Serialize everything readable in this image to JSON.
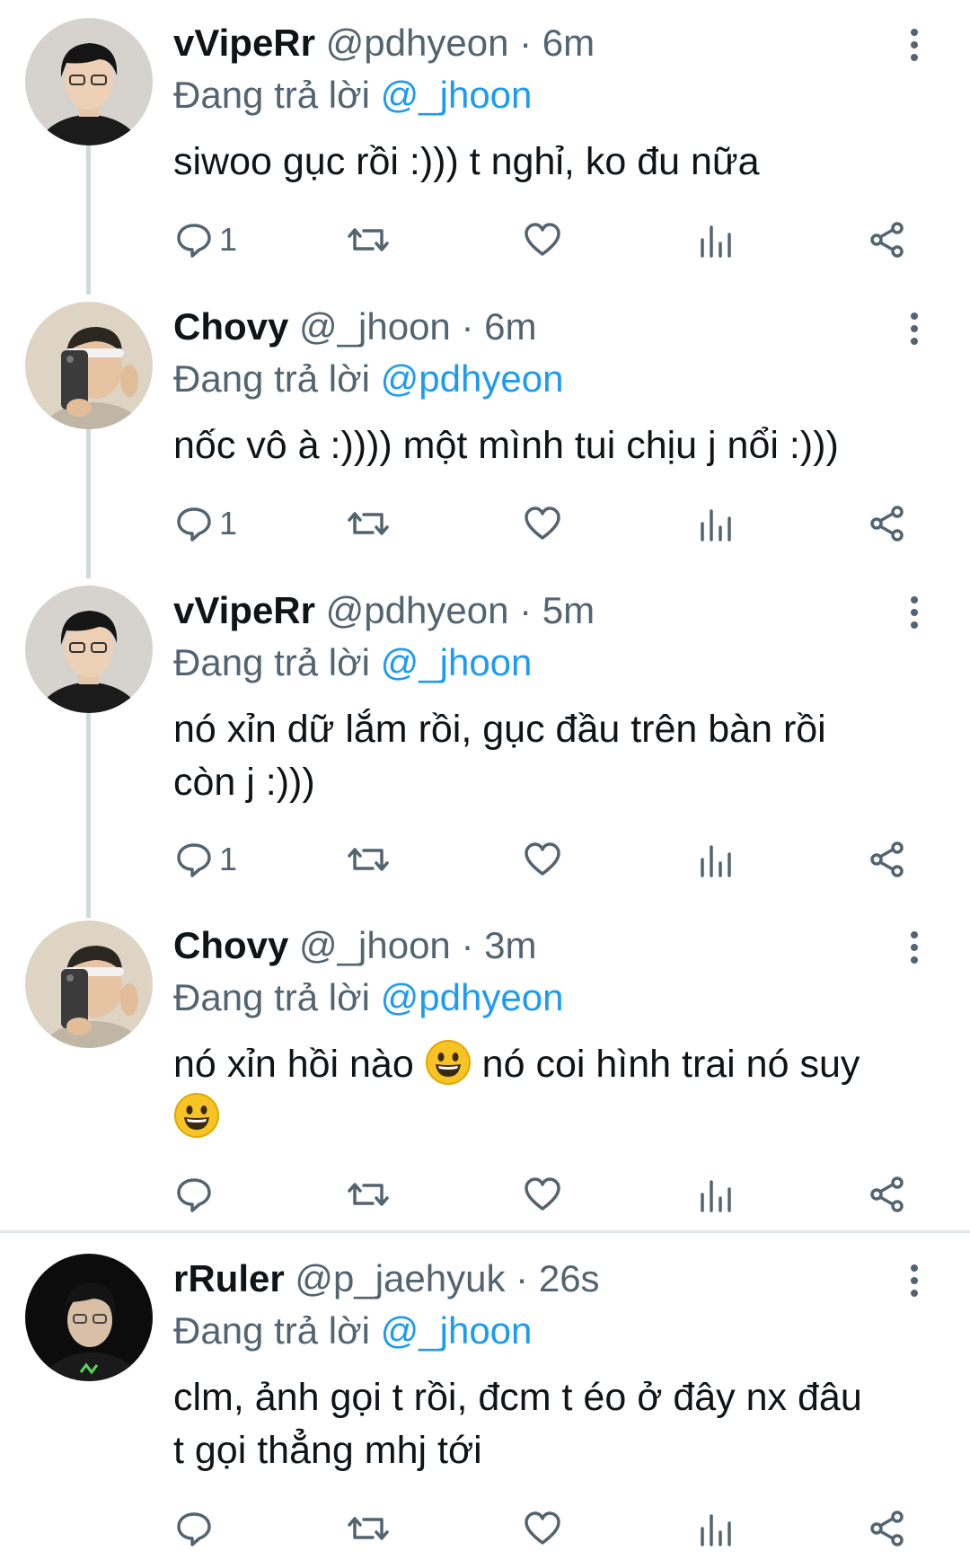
{
  "tweets": [
    {
      "name": "vVipeRr",
      "handle": "@pdhyeon",
      "separator": "·",
      "time": "6m",
      "reply_prefix": "Đang trả lời",
      "reply_to": "@_jhoon",
      "lines": [
        "siwoo gục rồi :))) t nghỉ, ko đu nữa"
      ],
      "reply_count": "1"
    },
    {
      "name": "Chovy",
      "handle": "@_jhoon",
      "separator": "·",
      "time": "6m",
      "reply_prefix": "Đang trả lời",
      "reply_to": "@pdhyeon",
      "lines": [
        "nốc vô à :)))) một mình tui chịu j nổi :)))"
      ],
      "reply_count": "1"
    },
    {
      "name": "vVipeRr",
      "handle": "@pdhyeon",
      "separator": "·",
      "time": "5m",
      "reply_prefix": "Đang trả lời",
      "reply_to": "@_jhoon",
      "lines": [
        "nó xỉn dữ lắm rồi, gục đầu trên bàn rồi",
        "còn j :)))"
      ],
      "reply_count": "1"
    },
    {
      "name": "Chovy",
      "handle": "@_jhoon",
      "separator": "·",
      "time": "3m",
      "reply_prefix": "Đang trả lời",
      "reply_to": "@pdhyeon",
      "lines": [
        "nó xỉn hồi nào",
        "nó coi hình trai nó suy"
      ],
      "reply_count": ""
    },
    {
      "name": "rRuler",
      "handle": "@p_jaehyuk",
      "separator": "·",
      "time": "26s",
      "reply_prefix": "Đang trả lời",
      "reply_to": "@_jhoon",
      "lines": [
        "clm, ảnh gọi t rồi, đcm t éo ở đây nx đâu",
        "t gọi thẳng mhj tới"
      ],
      "reply_count": ""
    }
  ],
  "icons": {
    "reply": "reply-icon",
    "retweet": "retweet-icon",
    "like": "heart-icon",
    "views": "views-icon",
    "share": "share-icon",
    "more": "more-vertical-icon",
    "emoji": "grinning-face-emoji"
  },
  "colors": {
    "text": "#0f1419",
    "secondary": "#536471",
    "mention": "#1d9bf0",
    "thread_line": "#cfd9de"
  }
}
